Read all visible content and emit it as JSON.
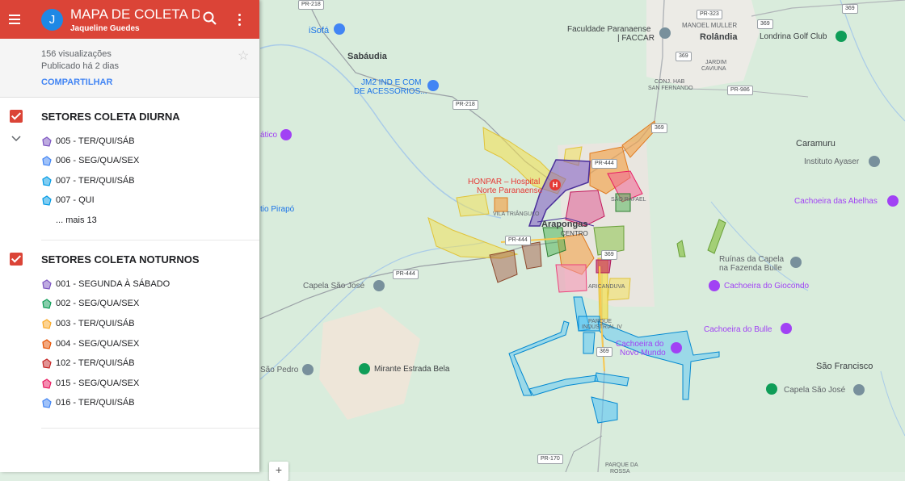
{
  "header": {
    "avatar_letter": "J",
    "title": "MAPA DE COLETA DO...",
    "author": "Jaqueline Guedes"
  },
  "meta": {
    "views": "156 visualizações",
    "published": "Publicado há 2 dias",
    "share_label": "COMPARTILHAR"
  },
  "layers": [
    {
      "title": "SETORES COLETA DIURNA",
      "items": [
        {
          "label": "005 - TER/QUI/SÁB",
          "color": "#7e57c2"
        },
        {
          "label": "006 - SEG/QUA/SEX",
          "color": "#4285f4"
        },
        {
          "label": "007 - TER/QUI/SÁB",
          "color": "#039be5"
        },
        {
          "label": "007 - QUI",
          "color": "#039be5"
        }
      ],
      "more": "... mais 13"
    },
    {
      "title": "SETORES COLETA NOTURNOS",
      "items": [
        {
          "label": "001 - SEGUNDA À SÁBADO",
          "color": "#7e57c2"
        },
        {
          "label": "002 - SEG/QUA/SEX",
          "color": "#0f9d58"
        },
        {
          "label": "003 - TER/QUI/SÁB",
          "color": "#f9a825"
        },
        {
          "label": "004 - SEG/QUA/SEX",
          "color": "#e65100"
        },
        {
          "label": "102 - TER/QUI/SÁB",
          "color": "#c62828"
        },
        {
          "label": "015 - SEG/QUA/SEX",
          "color": "#e91e63"
        },
        {
          "label": "016 - TER/QUI/SÁB",
          "color": "#4285f4"
        }
      ]
    }
  ],
  "map": {
    "places": {
      "sabaudia": "Sabáudia",
      "isofa": "iSofá",
      "jm2_line1": "JM2 IND E COM",
      "jm2_line2": "DE ACESSORIOS...",
      "faccar_line1": "Faculdade Paranaense",
      "faccar_line2": "| FACCAR",
      "manoel_muller": "MANOEL MULLER",
      "rolandia": "Rolândia",
      "londrina_golf": "Londrina Golf Club",
      "jardim_caviuna_1": "JARDIM",
      "jardim_caviuna_2": "CAVIUNA",
      "conj_hab_1": "CONJ. HAB",
      "conj_hab_2": "SAN FERNANDO",
      "caramuru": "Caramuru",
      "instituto": "Instituto Ayaser",
      "cachoeira_abelhas": "Cachoeira das Abelhas",
      "honpar_1": "HONPAR – Hospital",
      "honpar_2": "Norte Paranaense",
      "sao_rafael": "SÃO RAFAEL",
      "vila_triangulo": "VILA TRIÂNGULO",
      "arapongas": "Arapongas",
      "centro": "CENTRO",
      "ruinas_1": "Ruínas da Capela",
      "ruinas_2": "na Fazenda Bulle",
      "cachoeira_giocondo": "Cachoeira do Giocondo",
      "capela_sao_jose": "Capela São José",
      "aricanduva": "ARICANDUVA",
      "parque_ind_1": "PARQUE",
      "parque_ind_2": "INDUSTRIAL IV",
      "cachoeira_bulle": "Cachoeira do Bulle",
      "cachoeira_novo_1": "Cachoeira do",
      "cachoeira_novo_2": "Novo Mundo",
      "sao_pedro": "São Pedro",
      "mirante": "Mirante Estrada Bela",
      "sao_francisco": "São Francisco",
      "capela_sao_jose_2": "Capela São José",
      "rio_pirapo": "tio Pirapó",
      "atico": "ático",
      "parque_da_1": "PARQUE DA",
      "parque_da_2": "ROSSA"
    },
    "roads": {
      "pr218_top": "PR-218",
      "pr218": "PR-218",
      "pr323": "PR-323",
      "r369_a": "369",
      "r369_b": "369",
      "r369_c": "369",
      "r369_d": "369",
      "r369_e": "369",
      "r369_f": "369",
      "pr986": "PR-986",
      "pr444_a": "PR-444",
      "pr444_b": "PR-444",
      "pr444_c": "PR-444",
      "pr170": "PR-170"
    },
    "zoom_in": "+"
  }
}
